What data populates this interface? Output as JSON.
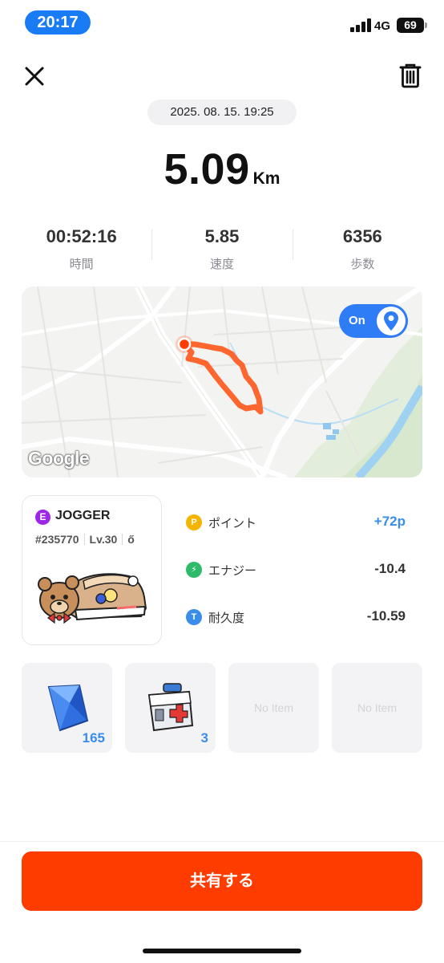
{
  "status_bar": {
    "time": "20:17",
    "network": "4G",
    "battery": "69"
  },
  "header": {
    "date": "2025. 08. 15. 19:25"
  },
  "distance": {
    "value": "5.09",
    "unit": "Km"
  },
  "stats": [
    {
      "value": "00:52:16",
      "label": "時間"
    },
    {
      "value": "5.85",
      "label": "速度"
    },
    {
      "value": "6356",
      "label": "歩数"
    }
  ],
  "map": {
    "toggle_label": "On",
    "logo": "Google"
  },
  "sneaker": {
    "badge": "E",
    "type": "JOGGER",
    "id": "#235770",
    "level": "Lv.30",
    "glyph": "ő"
  },
  "rewards": [
    {
      "icon": "points-icon",
      "badge": "P",
      "color": "#f5b400",
      "label": "ポイント",
      "value": "+72p",
      "value_color": "#3a8de8"
    },
    {
      "icon": "energy-icon",
      "badge": "⚡",
      "color": "#2dbb6a",
      "label": "エナジー",
      "value": "-10.4",
      "value_color": "#333333"
    },
    {
      "icon": "durability-icon",
      "badge": "T",
      "color": "#3a8de8",
      "label": "耐久度",
      "value": "-10.59",
      "value_color": "#333333"
    }
  ],
  "items": [
    {
      "icon": "blue-gem-icon",
      "count": "165"
    },
    {
      "icon": "repair-kit-icon",
      "count": "3"
    },
    {
      "empty_label": "No Item"
    },
    {
      "empty_label": "No Item"
    }
  ],
  "share_button": "共有する",
  "colors": {
    "accent": "#ff3c00",
    "blue": "#2f7df6",
    "route": "#ff5a1f"
  }
}
